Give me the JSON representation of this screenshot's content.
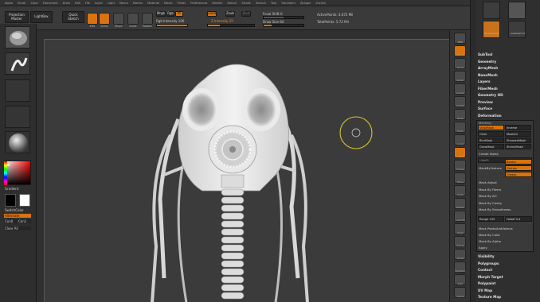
{
  "menubar": [
    "Alpha",
    "Brush",
    "Color",
    "Document",
    "Draw",
    "Edit",
    "File",
    "Layer",
    "Light",
    "Macro",
    "Marker",
    "Material",
    "Movie",
    "Picker",
    "Preferences",
    "Render",
    "Stencil",
    "Stroke",
    "Texture",
    "Tool",
    "Transform",
    "Zplugin",
    "Zscript"
  ],
  "toolbar": {
    "projection_master": "Projection Master",
    "lightbox": "LightBox",
    "quick_sketch": "Quick Sketch",
    "edit": "Edit",
    "draw": "Draw",
    "move": "Move",
    "scale": "Scale",
    "rotate": "Rotate",
    "mrgb": "Mrgb",
    "rgb": "Rgb",
    "m": "M",
    "zadd": "Zadd",
    "zsub": "Zsub",
    "zcut": "Zcut",
    "rgb_intensity": "Rgb Intensity 100",
    "z_intensity": "Z Intensity 25",
    "focal_shift": "Focal Shift 0",
    "draw_size": "Draw Size 64",
    "active_points": "ActivePoints: 4.672 Mil",
    "total_points": "TotalPoints: 5.72 Mil"
  },
  "leftpanel": {
    "gradient": "Gradient",
    "switch_color": "SwitchColor",
    "alternate": "Alternate",
    "con_0": "Con0",
    "con_1": "Con1",
    "clear_all": "Clear All"
  },
  "rightshelf": [
    "BPR",
    "SPix 3",
    "Scroll",
    "Zoom",
    "Actual",
    "AAHalf",
    "Persp",
    "Floor",
    "Local",
    "L.Sym",
    "Frame",
    "Move",
    "Scale",
    "Rotate",
    "Line Fill",
    "PolyF",
    "Transp",
    "Ghost",
    "Dynamic",
    "Solo",
    "Xpose"
  ],
  "toolpanel": {
    "tool1": "SimpleBrush",
    "tool2": "Cylinder3D",
    "tool3": "PolyMesh3D",
    "tool4": "GasMaskFull"
  },
  "sections_top": [
    "SubTool",
    "Geometry",
    "ArrayMesh",
    "NanoMesh",
    "Layers",
    "FiberMesh",
    "Geometry HD",
    "Preview",
    "Surface",
    "Deformation"
  ],
  "masking": {
    "title": "Masking",
    "grid": [
      [
        "ViewMask",
        "Inverse"
      ],
      [
        "Clear",
        "MaskAll"
      ],
      [
        "BlurMask",
        "SharpenMask"
      ],
      [
        "GrowMask",
        "ShrinkMask"
      ]
    ],
    "create_alpha": "Create Alpha",
    "hide_pt": "HidePt",
    "mask_by_feature": "MaskByFeature",
    "border": "Border",
    "groups": "Groups",
    "crease": "Crease",
    "items": [
      "Mask Adjust",
      "Mask By Fibers",
      "Mask By AO",
      "Mask By Cavity",
      "Mask By Smoothness"
    ],
    "range_label": "Range 100",
    "falloff_label": "Falloff 0.4",
    "mask_peaks": "Mask PeaksAndValleys",
    "mask_by_color": "Mask By Color",
    "mask_by_alpha": "Mask By Alpha",
    "apply": "Apply"
  },
  "sections_bottom": [
    "Visibility",
    "Polygroups",
    "Contact",
    "Morph Target",
    "Polypaint",
    "UV Map",
    "Texture Map"
  ],
  "colors": {
    "accent": "#d9730e",
    "bg": "#2a2a2a",
    "canvas": "#3b3b3b",
    "model": "#dcdcdc"
  }
}
